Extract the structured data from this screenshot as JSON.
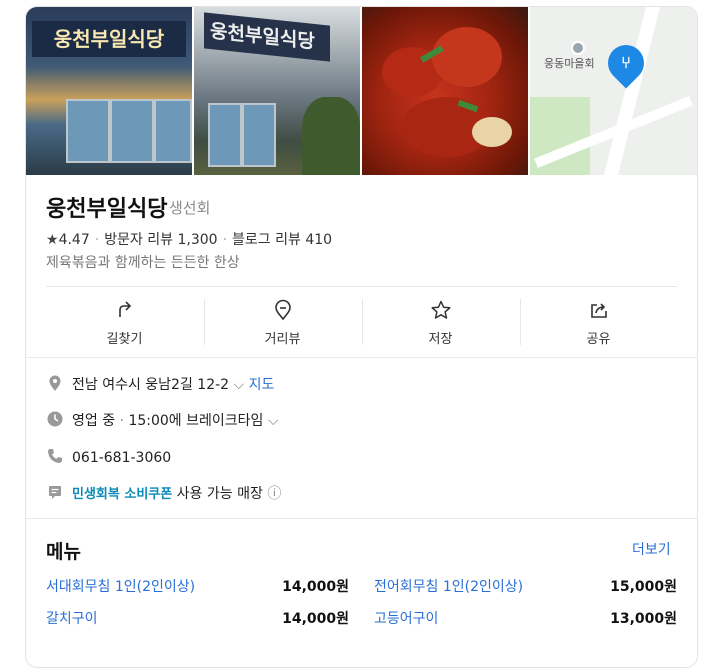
{
  "place": {
    "name": "웅천부일식당",
    "category": "생선회",
    "rating": "4.47",
    "visitor_review_label": "방문자 리뷰",
    "visitor_review_count": "1,300",
    "blog_review_label": "블로그 리뷰",
    "blog_review_count": "410",
    "description": "제육볶음과 함께하는 든든한 한상"
  },
  "photos": {
    "sign_text": "웅천부일식당",
    "map_label": "웅동마을회"
  },
  "actions": [
    {
      "label": "길찾기",
      "icon": "directions-icon"
    },
    {
      "label": "거리뷰",
      "icon": "street-view-icon"
    },
    {
      "label": "저장",
      "icon": "star-icon"
    },
    {
      "label": "공유",
      "icon": "share-icon"
    }
  ],
  "info": {
    "address": "전남 여수시 웅남2길 12-2",
    "map_link": "지도",
    "status": "영업 중",
    "status_detail": "15:00에 브레이크타임",
    "phone": "061-681-3060",
    "coupon_badge": "민생회복 소비쿠폰",
    "coupon_text": "사용 가능 매장"
  },
  "menu": {
    "heading": "메뉴",
    "more_label": "더보기",
    "items": [
      {
        "name": "서대회무침 1인(2인이상)",
        "price": "14,000원"
      },
      {
        "name": "전어회무침 1인(2인이상)",
        "price": "15,000원"
      },
      {
        "name": "갈치구이",
        "price": "14,000원"
      },
      {
        "name": "고등어구이",
        "price": "13,000원"
      }
    ]
  }
}
